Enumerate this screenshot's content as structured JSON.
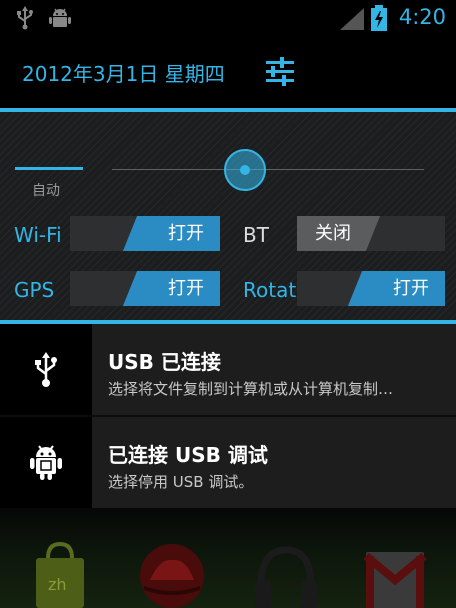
{
  "status_bar": {
    "time": "4:20",
    "icons": [
      "usb-icon",
      "android-debug-icon",
      "signal-icon",
      "battery-charging-icon"
    ],
    "accent": "#33b5e5"
  },
  "header": {
    "date": "2012年3月1日 星期四",
    "settings_icon": "settings-sliders-icon"
  },
  "brightness": {
    "auto_label": "自动",
    "level": 0.35
  },
  "toggles": [
    {
      "label": "Wi-Fi",
      "state": "打开",
      "on": true
    },
    {
      "label": "BT",
      "state": "关闭",
      "on": false
    },
    {
      "label": "GPS",
      "state": "打开",
      "on": true
    },
    {
      "label": "Rotate",
      "state": "打开",
      "on": true
    }
  ],
  "notifications": [
    {
      "icon": "usb-icon",
      "title": "USB 已连接",
      "text": "选择将文件复制到计算机或从计算机复制…"
    },
    {
      "icon": "android-debug-icon",
      "title": "已连接 USB 调试",
      "text": "选择停用 USB 调试。"
    }
  ],
  "dock": {
    "apps": [
      "shopping-bag-icon",
      "redhat-icon",
      "headphones-icon",
      "gmail-icon"
    ]
  },
  "colors": {
    "accent": "#33b5e5",
    "switch_on": "#2a8cc2",
    "switch_off": "#5a5c5e"
  }
}
